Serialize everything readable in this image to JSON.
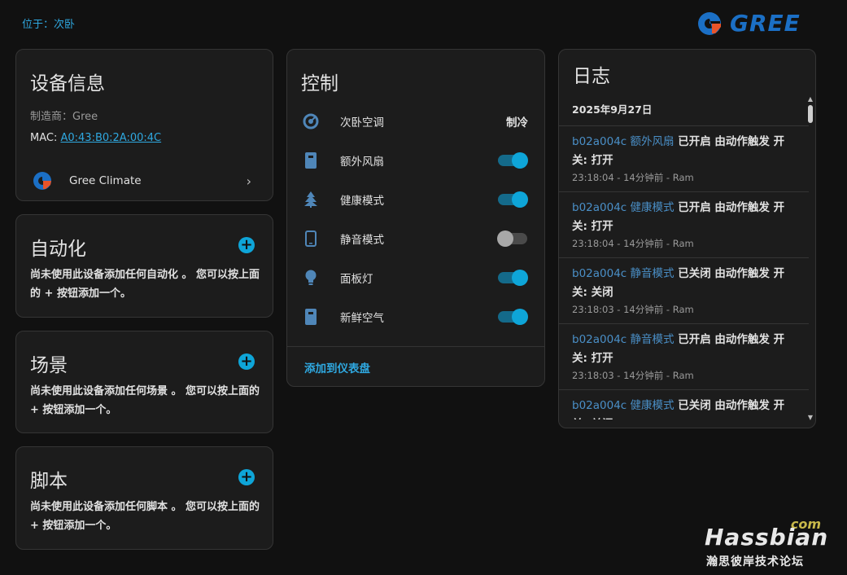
{
  "breadcrumb": "位于：次卧",
  "brand": {
    "wordmark": "GREE",
    "color": "#1b6fc5",
    "accent": "#e8542a"
  },
  "device_info": {
    "title": "设备信息",
    "manufacturer": "制造商：Gree",
    "mac_label": "MAC: ",
    "mac_value": "A0:43:B0:2A:00:4C",
    "integration": {
      "name": "Gree Climate",
      "icon": "gree-logo-icon",
      "chevron": "›"
    }
  },
  "automation": {
    "title": "自动化",
    "add_icon": "+",
    "description": "尚未使用此设备添加任何自动化 。 您可以按上面的 + 按钮添加一个。"
  },
  "scene": {
    "title": "场景",
    "add_icon": "+",
    "description": "尚未使用此设备添加任何场景 。 您可以按上面的 + 按钮添加一个。"
  },
  "script": {
    "title": "脚本",
    "add_icon": "+",
    "description": "尚未使用此设备添加任何脚本 。 您可以按上面的 + 按钮添加一个。"
  },
  "control": {
    "title": "控制",
    "items": [
      {
        "label": "次卧空调",
        "icon": "thermostat-icon",
        "state": "制冷"
      },
      {
        "label": "额外风扇",
        "icon": "remote-icon",
        "toggle": "on"
      },
      {
        "label": "健康模式",
        "icon": "tree-icon",
        "toggle": "on"
      },
      {
        "label": "静音模式",
        "icon": "phone-icon",
        "toggle": "off"
      },
      {
        "label": "面板灯",
        "icon": "lightbulb-icon",
        "toggle": "on"
      },
      {
        "label": "新鲜空气",
        "icon": "remote-icon",
        "toggle": "on"
      }
    ],
    "add_to_dashboard": "添加到仪表盘"
  },
  "log": {
    "title": "日志",
    "date": "2025年9月27日",
    "entries": [
      {
        "entity": "b02a004c 额外风扇",
        "action": " 已开启 由动作触发 开关: 打开",
        "meta": "23:18:04 - 14分钟前 - Ram"
      },
      {
        "entity": "b02a004c 健康模式",
        "action": " 已开启 由动作触发 开关: 打开",
        "meta": "23:18:04 - 14分钟前 - Ram"
      },
      {
        "entity": "b02a004c 静音模式",
        "action": " 已关闭 由动作触发 开关: 关闭",
        "meta": "23:18:03 - 14分钟前 - Ram"
      },
      {
        "entity": "b02a004c 静音模式",
        "action": " 已开启 由动作触发 开关: 打开",
        "meta": "23:18:03 - 14分钟前 - Ram"
      },
      {
        "entity": "b02a004c 健康模式",
        "action": " 已关闭 由动作触发 开关: 关闭",
        "meta": ""
      }
    ]
  },
  "watermark": {
    "com": "com",
    "name": "Hassbian",
    "sub": "瀚思彼岸技术论坛"
  },
  "colors": {
    "accent": "#0ea5d8",
    "link": "#2fa8e0",
    "card_bg": "#1c1c1c",
    "page_bg": "#111111"
  }
}
